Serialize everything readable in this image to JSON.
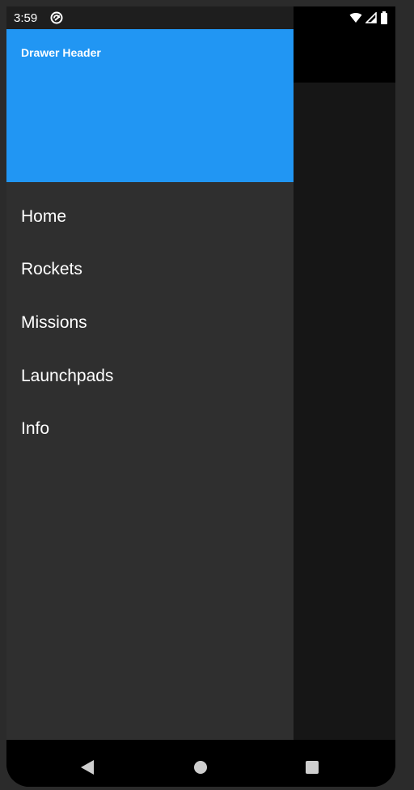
{
  "status_bar": {
    "time": "3:59",
    "app_icon": "sync-circle-icon",
    "wifi_icon": "wifi-icon",
    "signal_icon": "cell-signal-icon",
    "battery_icon": "battery-icon"
  },
  "drawer": {
    "header_title": "Drawer Header",
    "header_color": "#2196f3",
    "items": [
      {
        "label": "Home"
      },
      {
        "label": "Rockets"
      },
      {
        "label": "Missions"
      },
      {
        "label": "Launchpads"
      },
      {
        "label": "Info"
      }
    ]
  },
  "nav_bar": {
    "back_icon": "back-triangle-icon",
    "home_icon": "home-circle-icon",
    "recents_icon": "recents-square-icon"
  }
}
